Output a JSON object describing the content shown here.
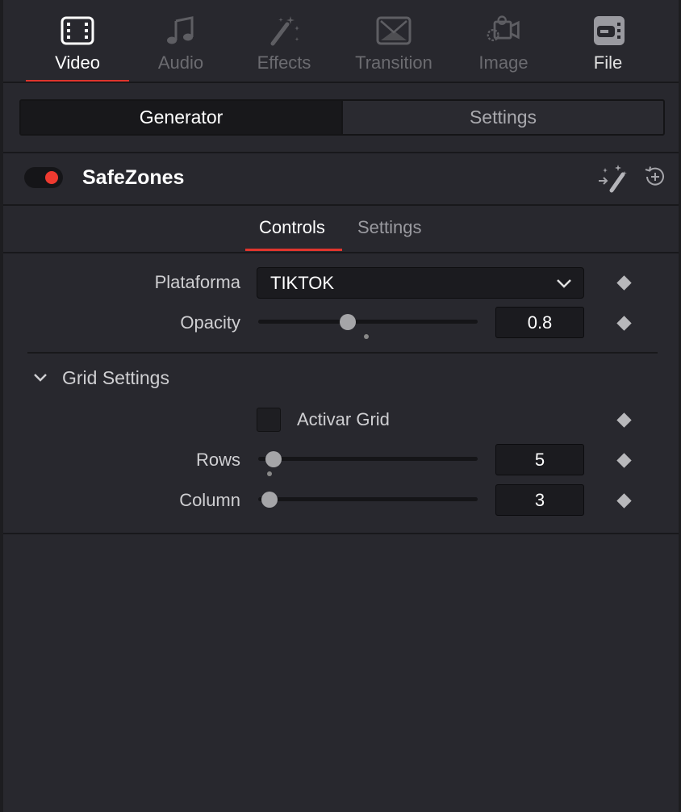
{
  "top_tabs": [
    {
      "label": "Video",
      "icon": "film-icon"
    },
    {
      "label": "Audio",
      "icon": "music-note-icon"
    },
    {
      "label": "Effects",
      "icon": "magic-wand-icon"
    },
    {
      "label": "Transition",
      "icon": "transition-icon"
    },
    {
      "label": "Image",
      "icon": "camera-icon"
    },
    {
      "label": "File",
      "icon": "file-tag-icon"
    }
  ],
  "segmented": {
    "generator": "Generator",
    "settings": "Settings"
  },
  "effect": {
    "title": "SafeZones",
    "enabled": true
  },
  "sub_tabs": {
    "controls": "Controls",
    "settings": "Settings"
  },
  "controls": {
    "plataforma": {
      "label": "Plataforma",
      "value": "TIKTOK"
    },
    "opacity": {
      "label": "Opacity",
      "value": "0.8"
    },
    "grid_group": {
      "label": "Grid Settings",
      "expanded": true
    },
    "activar_grid": {
      "label": "Activar Grid",
      "checked": false
    },
    "rows": {
      "label": "Rows",
      "value": "5"
    },
    "column": {
      "label": "Column",
      "value": "3"
    }
  },
  "colors": {
    "accent": "#e0352d",
    "toggle_on": "#ee3a30",
    "background": "#28282e"
  }
}
